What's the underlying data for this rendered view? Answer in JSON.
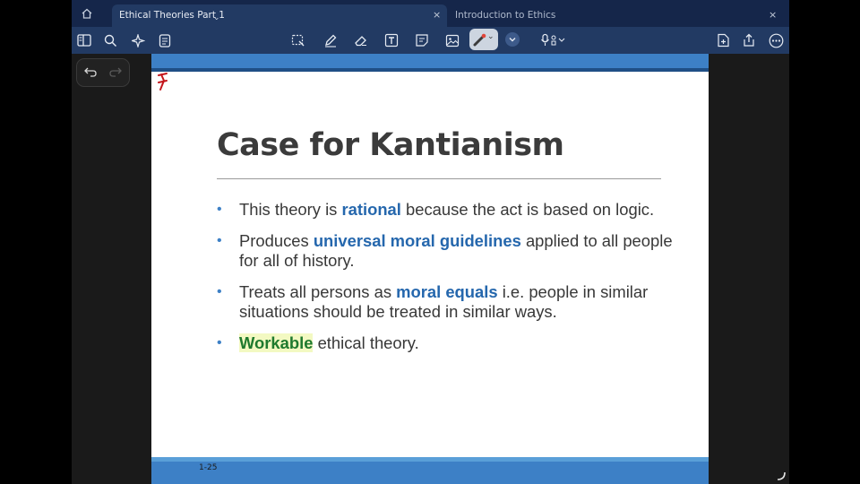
{
  "tabs": [
    {
      "label": "Ethical Theories Part 1",
      "active": true
    },
    {
      "label": "Introduction to Ethics",
      "active": false
    }
  ],
  "toolbar": {
    "left_tools": [
      "sidebar-icon",
      "search-icon",
      "sparkle-icon",
      "document-icon"
    ],
    "center_tools": [
      "lasso-icon",
      "pen-icon",
      "eraser-icon",
      "text-box-icon",
      "sticky-note-icon",
      "image-icon",
      "laser-pointer-icon",
      "chevron-down-icon",
      "microphone-icon"
    ],
    "right_tools": [
      "add-page-icon",
      "share-icon",
      "more-icon"
    ]
  },
  "undo_panel": {
    "undo": "undo-icon",
    "redo": "redo-icon"
  },
  "slide": {
    "title": "Case for Kantianism",
    "page_number": "1-25",
    "bullets": [
      {
        "before": "This theory is ",
        "highlight": "rational",
        "after": " because the act is based on logic."
      },
      {
        "before": "Produces ",
        "highlight": "universal moral guidelines",
        "after": " applied to all people for all of history."
      },
      {
        "before": "Treats all persons as ",
        "highlight": "moral equals",
        "after": " i.e. people in similar situations should be treated in similar ways."
      },
      {
        "before": "",
        "highlight": "Workable",
        "after": " ethical theory."
      }
    ]
  },
  "colors": {
    "tab_bar": "#15264a",
    "toolbar": "#223a63",
    "slide_accent": "#3d80c6",
    "highlight_text": "#2567ad",
    "green_highlight": "#1f7a2e"
  }
}
